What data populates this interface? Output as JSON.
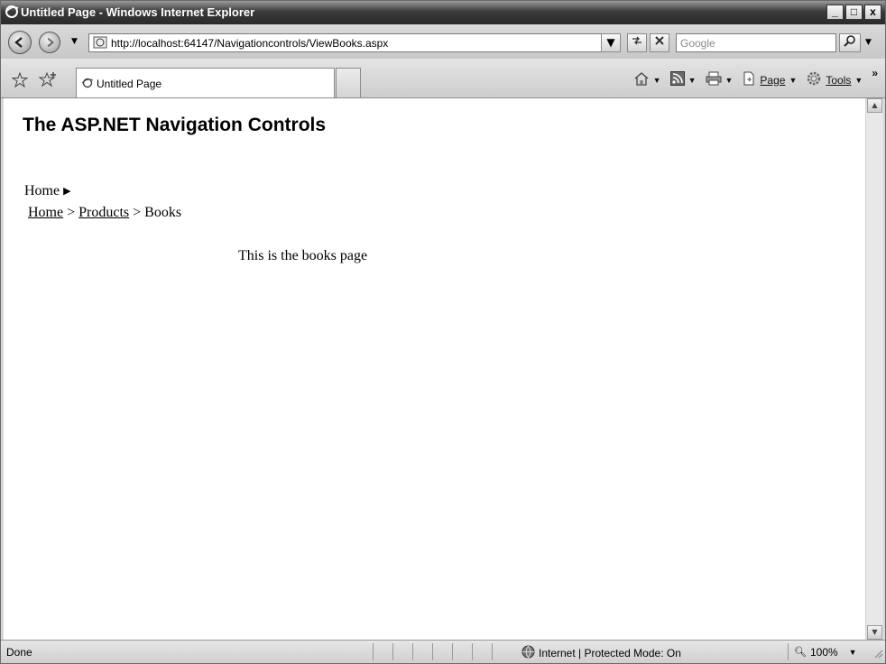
{
  "window": {
    "title": "Untitled Page - Windows Internet Explorer",
    "minimize": "_",
    "maximize": "□",
    "close": "x"
  },
  "addressbar": {
    "url": "http://localhost:64147/Navigationcontrols/ViewBooks.aspx",
    "search_placeholder": "Google"
  },
  "tab": {
    "label": "Untitled Page"
  },
  "command_bar": {
    "page": "Page",
    "tools": "Tools",
    "more": "»"
  },
  "page": {
    "heading": "The ASP.NET Navigation Controls",
    "menu_item": "Home",
    "breadcrumb": {
      "home": "Home",
      "sep1": " > ",
      "products": "Products",
      "sep2": " > ",
      "current": "Books"
    },
    "body": "This is the books page"
  },
  "status": {
    "text": "Done",
    "zone": "Internet | Protected Mode: On",
    "zoom": "100%"
  },
  "colors": {
    "titlebar": "#2a2a2a",
    "chrome": "#d6d6d6",
    "content_bg": "#ffffff"
  }
}
